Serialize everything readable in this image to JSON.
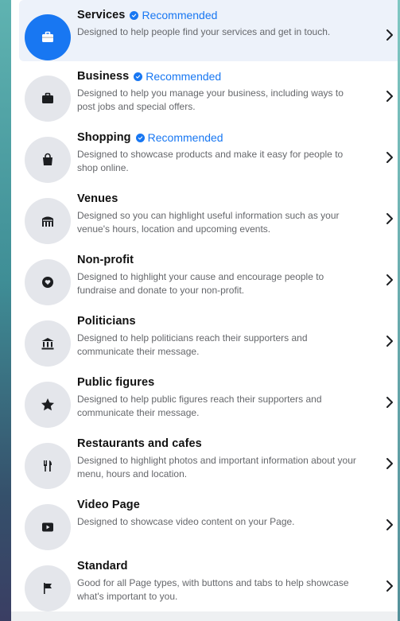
{
  "colors": {
    "accent": "#1877f2",
    "active_row_bg": "#edf2fa",
    "icon_circle_bg": "#e4e6eb",
    "title_text": "#111111",
    "desc_text": "#65676b"
  },
  "recommended_label": "Recommended",
  "page_types": [
    {
      "title": "Services",
      "recommended": true,
      "active": true,
      "icon": "briefcase-icon",
      "description": "Designed to help people find your services and get in touch."
    },
    {
      "title": "Business",
      "recommended": true,
      "active": false,
      "icon": "briefcase-icon",
      "description": "Designed to help you manage your business, including ways to post jobs and special offers."
    },
    {
      "title": "Shopping",
      "recommended": true,
      "active": false,
      "icon": "shopping-bag-icon",
      "description": "Designed to showcase products and make it easy for people to shop online."
    },
    {
      "title": "Venues",
      "recommended": false,
      "active": false,
      "icon": "venue-icon",
      "description": "Designed so you can highlight useful information such as your venue's hours, location and upcoming events."
    },
    {
      "title": "Non-profit",
      "recommended": false,
      "active": false,
      "icon": "heart-hand-icon",
      "description": "Designed to highlight your cause and encourage people to fundraise and donate to your non-profit."
    },
    {
      "title": "Politicians",
      "recommended": false,
      "active": false,
      "icon": "government-building-icon",
      "description": "Designed to help politicians reach their supporters and communicate their message."
    },
    {
      "title": "Public figures",
      "recommended": false,
      "active": false,
      "icon": "star-icon",
      "description": "Designed to help public figures reach their supporters and communicate their message."
    },
    {
      "title": "Restaurants and cafes",
      "recommended": false,
      "active": false,
      "icon": "fork-knife-icon",
      "description": "Designed to highlight photos and important information about your menu, hours and location."
    },
    {
      "title": "Video Page",
      "recommended": false,
      "active": false,
      "icon": "video-play-icon",
      "description": "Designed to showcase video content on your Page."
    },
    {
      "title": "Standard",
      "recommended": false,
      "active": false,
      "icon": "flag-icon",
      "description": "Good for all Page types, with buttons and tabs to help showcase what's important to you."
    }
  ]
}
